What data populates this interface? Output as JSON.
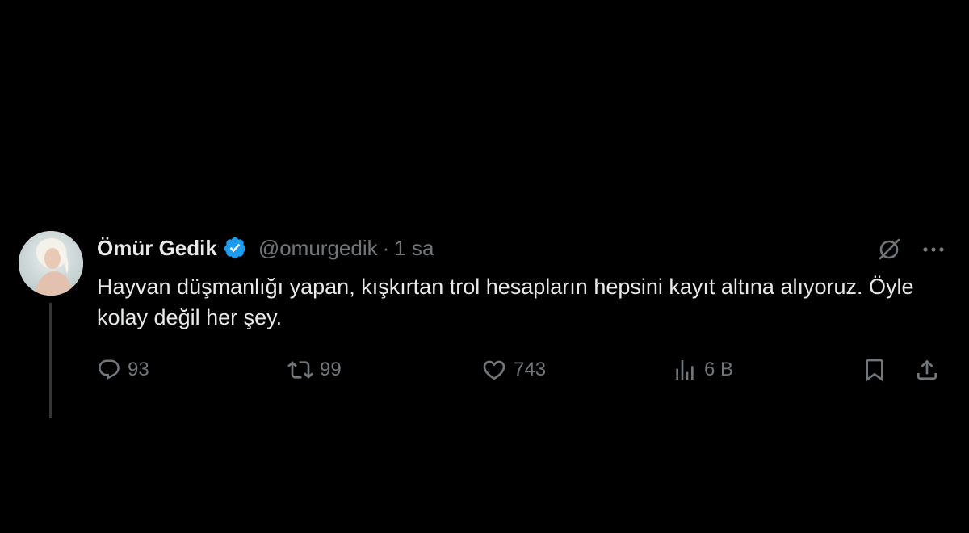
{
  "tweet": {
    "author_name": "Ömür Gedik",
    "handle": "@omurgedik",
    "separator": "·",
    "time": "1 sa",
    "text": "Hayvan düşmanlığı yapan, kışkırtan trol hesapların hepsini kayıt altına alıyoruz. Öyle kolay değil her şey.",
    "verified": true
  },
  "actions": {
    "replies": "93",
    "retweets": "99",
    "likes": "743",
    "views": "6 B"
  },
  "icons": {
    "verified": "verified-badge-icon",
    "grok": "grok-icon",
    "more": "more-icon",
    "reply": "reply-icon",
    "retweet": "retweet-icon",
    "like": "heart-icon",
    "views": "views-icon",
    "bookmark": "bookmark-icon",
    "share": "share-icon"
  },
  "colors": {
    "background": "#000000",
    "text": "#e7e9ea",
    "secondary": "#71767b",
    "verified": "#1d9bf0",
    "thread_line": "#333639"
  }
}
